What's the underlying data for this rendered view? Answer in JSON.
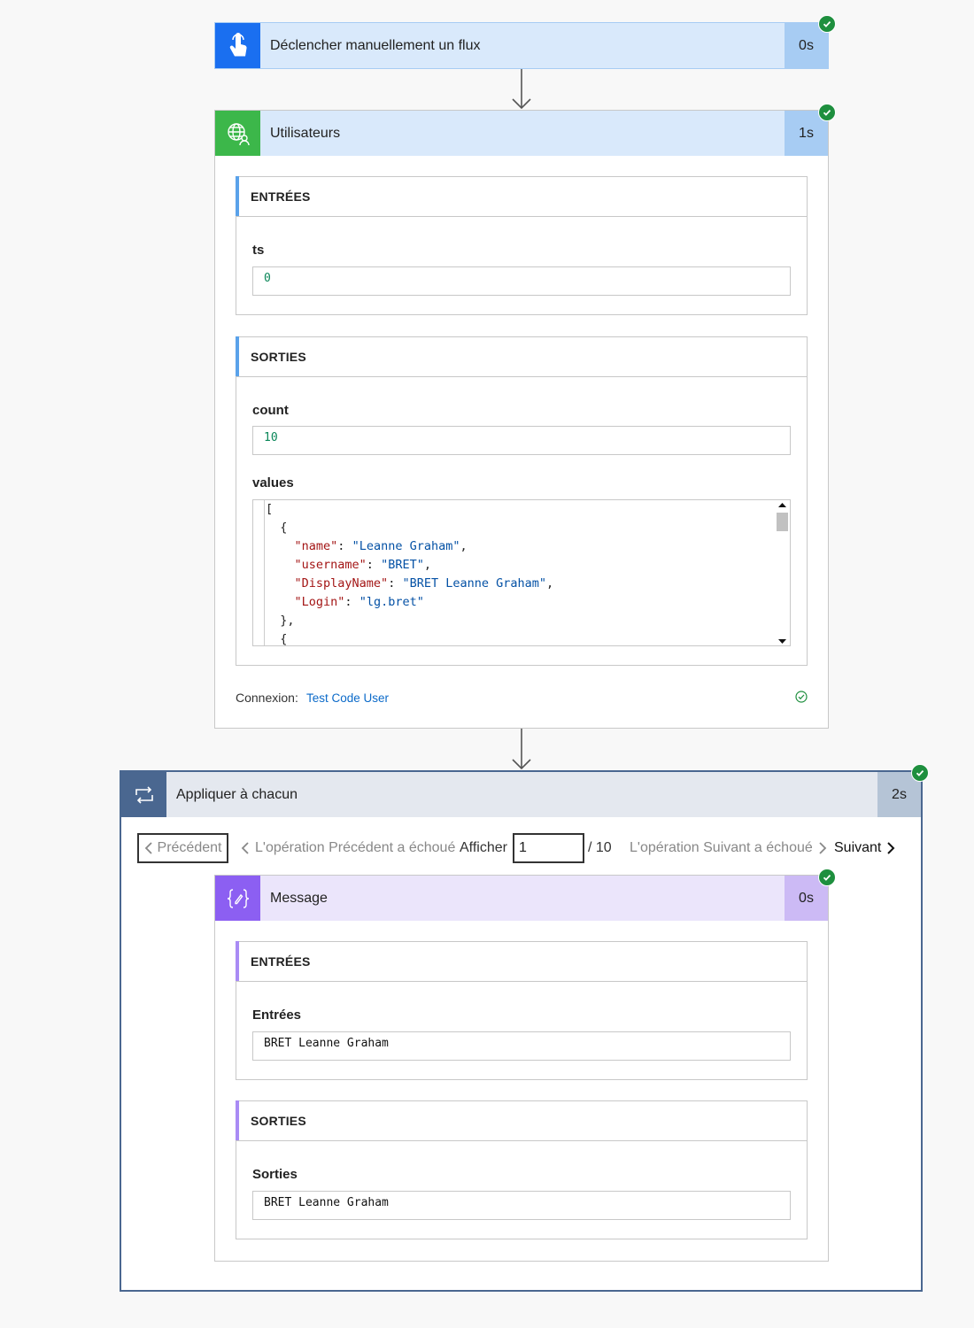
{
  "trigger": {
    "title": "Déclencher manuellement un flux",
    "duration": "0s"
  },
  "users": {
    "title": "Utilisateurs",
    "duration": "1s",
    "inputs_header": "ENTRÉES",
    "ts_label": "ts",
    "ts_value": "0",
    "outputs_header": "SORTIES",
    "count_label": "count",
    "count_value": "10",
    "values_label": "values",
    "code_lines": [
      {
        "indent": "",
        "parts": [
          {
            "t": "p",
            "v": "["
          }
        ]
      },
      {
        "indent": "  ",
        "parts": [
          {
            "t": "p",
            "v": "{"
          }
        ]
      },
      {
        "indent": "    ",
        "parts": [
          {
            "t": "k",
            "v": "\"name\""
          },
          {
            "t": "p",
            "v": ": "
          },
          {
            "t": "s",
            "v": "\"Leanne Graham\""
          },
          {
            "t": "p",
            "v": ","
          }
        ]
      },
      {
        "indent": "    ",
        "parts": [
          {
            "t": "k",
            "v": "\"username\""
          },
          {
            "t": "p",
            "v": ": "
          },
          {
            "t": "s",
            "v": "\"BRET\""
          },
          {
            "t": "p",
            "v": ","
          }
        ]
      },
      {
        "indent": "    ",
        "parts": [
          {
            "t": "k",
            "v": "\"DisplayName\""
          },
          {
            "t": "p",
            "v": ": "
          },
          {
            "t": "s",
            "v": "\"BRET Leanne Graham\""
          },
          {
            "t": "p",
            "v": ","
          }
        ]
      },
      {
        "indent": "    ",
        "parts": [
          {
            "t": "k",
            "v": "\"Login\""
          },
          {
            "t": "p",
            "v": ": "
          },
          {
            "t": "s",
            "v": "\"lg.bret\""
          }
        ]
      },
      {
        "indent": "  ",
        "parts": [
          {
            "t": "p",
            "v": "},"
          }
        ]
      },
      {
        "indent": "  ",
        "parts": [
          {
            "t": "p",
            "v": "{"
          }
        ]
      }
    ],
    "connection_label": "Connexion:",
    "connection_value": "Test Code User"
  },
  "loop": {
    "title": "Appliquer à chacun",
    "duration": "2s",
    "prev_button": "Précédent",
    "prev_failed": "L'opération Précédent a échoué",
    "show_label": "Afficher",
    "page_value": "1",
    "page_total": "/ 10",
    "next_failed": "L'opération Suivant a échoué",
    "next_button": "Suivant"
  },
  "message": {
    "title": "Message",
    "duration": "0s",
    "inputs_header": "ENTRÉES",
    "inputs_label": "Entrées",
    "inputs_value": "BRET Leanne Graham",
    "outputs_header": "SORTIES",
    "outputs_label": "Sorties",
    "outputs_value": "BRET Leanne Graham"
  },
  "colors": {
    "trigger_icon": "#1a6ff0",
    "trigger_header": "#d9e9fb",
    "trigger_duration": "#a7ccf3",
    "http_icon": "#3cb74a",
    "loop_icon": "#4a6790",
    "loop_header": "#e4e8ef",
    "loop_duration": "#b5c4d6",
    "message_icon": "#8c5ff2",
    "message_header": "#ebe5fb",
    "message_duration": "#ccbaf5",
    "success": "#1e8f3e",
    "link": "#0b6ac9"
  }
}
